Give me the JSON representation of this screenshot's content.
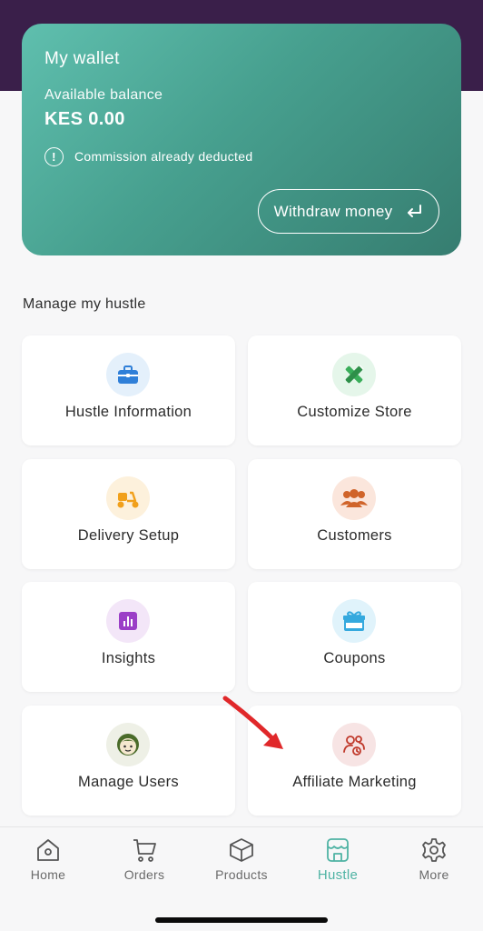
{
  "wallet": {
    "title": "My wallet",
    "balance_label": "Available balance",
    "balance_value": "KES 0.00",
    "note": "Commission already deducted",
    "withdraw_label": "Withdraw money"
  },
  "manage": {
    "title": "Manage my hustle",
    "tiles": [
      {
        "label": "Hustle Information",
        "icon": "briefcase-icon"
      },
      {
        "label": "Customize Store",
        "icon": "ruler-pencil-icon"
      },
      {
        "label": "Delivery Setup",
        "icon": "scooter-icon"
      },
      {
        "label": "Customers",
        "icon": "people-group-icon"
      },
      {
        "label": "Insights",
        "icon": "bar-chart-icon"
      },
      {
        "label": "Coupons",
        "icon": "gift-icon"
      },
      {
        "label": "Manage Users",
        "icon": "user-face-icon"
      },
      {
        "label": "Affiliate Marketing",
        "icon": "affiliate-users-icon"
      }
    ]
  },
  "nav": {
    "items": [
      {
        "label": "Home",
        "icon": "home-icon"
      },
      {
        "label": "Orders",
        "icon": "cart-icon"
      },
      {
        "label": "Products",
        "icon": "box-icon"
      },
      {
        "label": "Hustle",
        "icon": "storefront-icon",
        "active": true
      },
      {
        "label": "More",
        "icon": "gear-icon"
      }
    ]
  },
  "colors": {
    "header_band": "#3a1f4a",
    "wallet_gradient_start": "#5fbfae",
    "wallet_gradient_end": "#367d70",
    "accent": "#4fb3a4",
    "annotation_arrow": "#e0282a"
  }
}
